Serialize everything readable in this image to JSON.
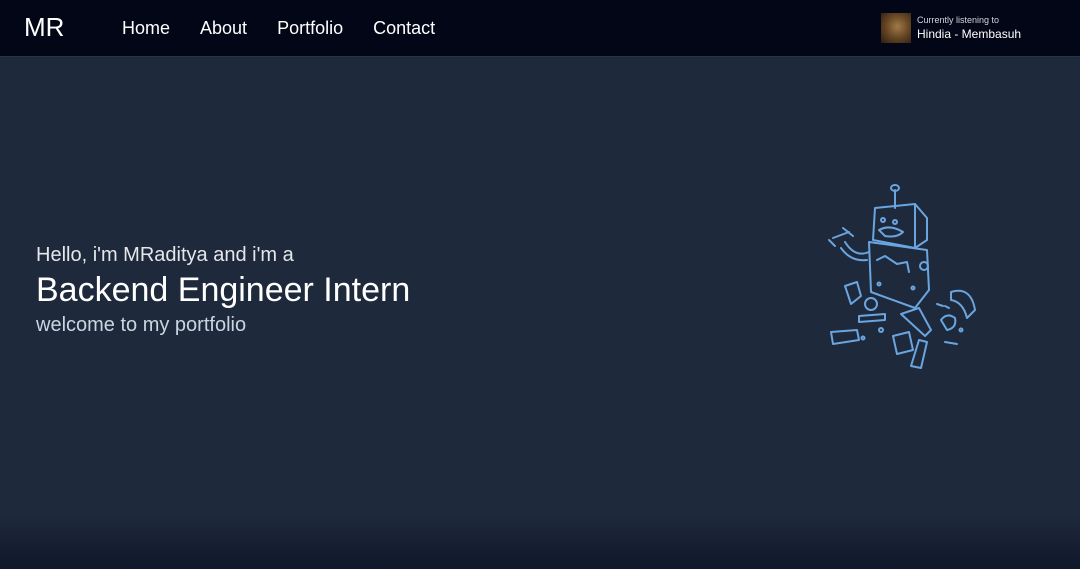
{
  "navbar": {
    "logo": "MR",
    "links": [
      {
        "label": "Home"
      },
      {
        "label": "About"
      },
      {
        "label": "Portfolio"
      },
      {
        "label": "Contact"
      }
    ],
    "now_playing": {
      "caption": "Currently listening to",
      "track": "Hindia - Membasuh",
      "icon": "album-art"
    }
  },
  "hero": {
    "greeting": "Hello, i'm MRaditya and i'm a",
    "role": "Backend Engineer Intern",
    "welcome": "welcome to my portfolio",
    "illustration": "broken-robot-illustration"
  },
  "colors": {
    "navbar_bg": "#030617",
    "page_bg": "#1e293b",
    "illustration_stroke": "#6aa5e0"
  }
}
